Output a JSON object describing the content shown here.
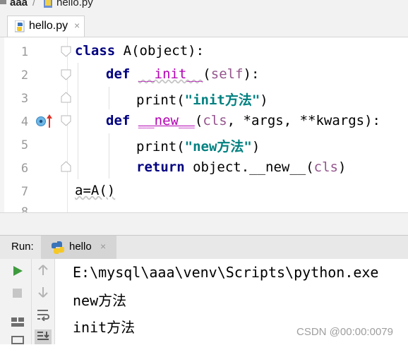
{
  "breadcrumb": {
    "project": "aaa",
    "file": "hello.py"
  },
  "editor": {
    "tab_label": "hello.py",
    "tab_close": "×",
    "line_numbers": [
      "1",
      "2",
      "3",
      "4",
      "5",
      "6",
      "7",
      "8"
    ],
    "lines": {
      "l1": {
        "kw": "class",
        "rest": " A(object):"
      },
      "l2": {
        "kw": "def",
        "fn": "__init__",
        "open": "(",
        "self": "self",
        "close": "):"
      },
      "l3": {
        "call": "print(",
        "str": "\"init方法\"",
        "end": ")"
      },
      "l4": {
        "kw": "def",
        "fn": "__new__",
        "open": "(",
        "cls": "cls",
        "rest": ", *args, **kwargs):"
      },
      "l5": {
        "call": "print(",
        "str": "\"new方法\"",
        "end": ")"
      },
      "l6": {
        "kw": "return",
        "mid": " object.__new__(",
        "cls": "cls",
        "end": ")"
      },
      "l7": {
        "text": "a=A()"
      }
    }
  },
  "run": {
    "label": "Run:",
    "tab_label": "hello",
    "tab_close": "×",
    "output": [
      "E:\\mysql\\aaa\\venv\\Scripts\\python.exe",
      "new方法",
      "init方法"
    ]
  },
  "watermark": "CSDN @00:00:0079",
  "colors": {
    "keyword": "#000080",
    "function": "#b200b2",
    "self": "#94558d",
    "string": "#008080",
    "run_green": "#3e9b3e"
  }
}
